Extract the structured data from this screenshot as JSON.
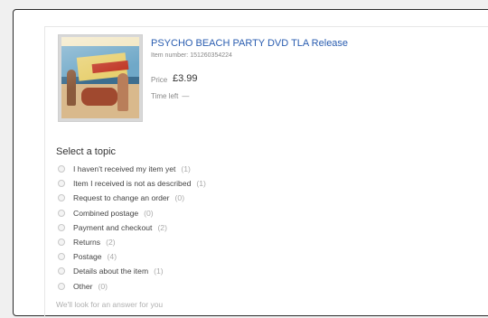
{
  "item": {
    "title": "PSYCHO BEACH PARTY DVD TLA Release",
    "item_number_label": "Item number:",
    "item_number": "151260354224",
    "price_label": "Price",
    "price": "£3.99",
    "time_left_label": "Time left",
    "time_left": "—"
  },
  "topics": {
    "heading": "Select a topic",
    "items": [
      {
        "label": "I haven't received my item yet",
        "count": "(1)"
      },
      {
        "label": "Item I received is not as described",
        "count": "(1)"
      },
      {
        "label": "Request to change an order",
        "count": "(0)"
      },
      {
        "label": "Combined postage",
        "count": "(0)"
      },
      {
        "label": "Payment and checkout",
        "count": "(2)"
      },
      {
        "label": "Returns",
        "count": "(2)"
      },
      {
        "label": "Postage",
        "count": "(4)"
      },
      {
        "label": "Details about the item",
        "count": "(1)"
      },
      {
        "label": "Other",
        "count": "(0)"
      }
    ]
  },
  "footer": {
    "text": "We'll look for an answer for you"
  },
  "colors": {
    "link": "#2a5db0",
    "muted": "#888888"
  }
}
